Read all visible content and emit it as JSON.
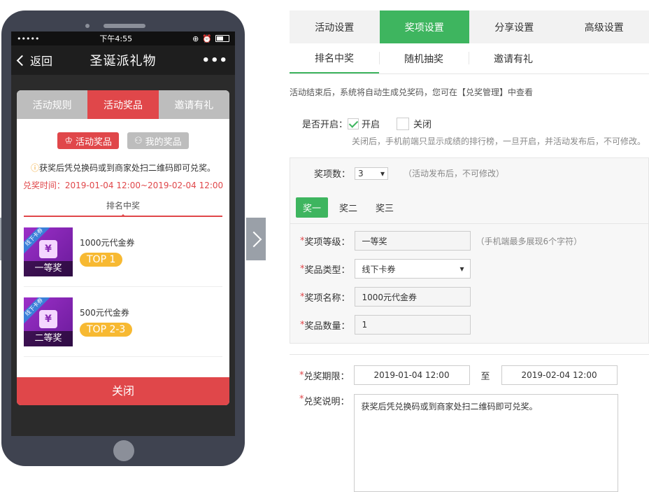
{
  "phone": {
    "status": {
      "carrier": "•••••",
      "time": "下午4:55",
      "icons": [
        "rotation-lock-icon",
        "alarm-icon",
        "battery-icon"
      ]
    },
    "nav": {
      "back_label": "返回",
      "title": "圣诞派礼物",
      "more_label": "•••"
    },
    "modal": {
      "tabs": [
        "活动规则",
        "活动奖品",
        "邀请有礼"
      ],
      "active_tab": 1,
      "buttons": {
        "prizes": "活动奖品",
        "my_prizes": "我的奖品"
      },
      "notice": "获奖后凭兑换码或到商家处扫二维码即可兑奖。",
      "redeem_time": "兑奖时间：2019-01-04 12:00~2019-02-04 12:00",
      "rank_tab": "排名中奖",
      "items": [
        {
          "ribbon": "线下卡券",
          "level": "一等奖",
          "name": "1000元代金券",
          "rank": "TOP 1"
        },
        {
          "ribbon": "线下卡券",
          "level": "二等奖",
          "name": "500元代金券",
          "rank": "TOP 2-3"
        }
      ],
      "close_label": "关闭"
    }
  },
  "panel": {
    "main_tabs": [
      "活动设置",
      "奖项设置",
      "分享设置",
      "高级设置"
    ],
    "active_main_tab": 1,
    "sub_tabs": [
      "排名中奖",
      "随机抽奖",
      "邀请有礼"
    ],
    "active_sub_tab": 0,
    "hint": "活动结束后，系统将自动生成兑奖码，您可在【兑奖管理】中查看",
    "enable": {
      "label": "是否开启：",
      "on_label": "开启",
      "off_label": "关闭",
      "checked": "on",
      "note": "关闭后，手机前端只显示成绩的排行榜，一旦开启，并活动发布后，不可修改。"
    },
    "prize_count": {
      "label": "奖项数：",
      "value": "3",
      "note": "（活动发布后，不可修改）"
    },
    "tiers": [
      "奖一",
      "奖二",
      "奖三"
    ],
    "active_tier": 0,
    "fields": {
      "level": {
        "label": "奖项等级：",
        "value": "一等奖",
        "note": "（手机端最多展现6个字符）"
      },
      "type": {
        "label": "奖品类型：",
        "value": "线下卡券"
      },
      "name": {
        "label": "奖项名称：",
        "value": "1000元代金券"
      },
      "qty": {
        "label": "奖品数量：",
        "value": "1"
      }
    },
    "period": {
      "label": "兑奖期限：",
      "start": "2019-01-04 12:00",
      "to": "至",
      "end": "2019-02-04 12:00"
    },
    "description": {
      "label": "兑奖说明：",
      "value": "获奖后凭兑换码或到商家处扫二维码即可兑奖。"
    }
  },
  "colors": {
    "red": "#e0474a",
    "green": "#3eb55f",
    "gold": "#f7b932",
    "purple": "#8a2bb5"
  }
}
